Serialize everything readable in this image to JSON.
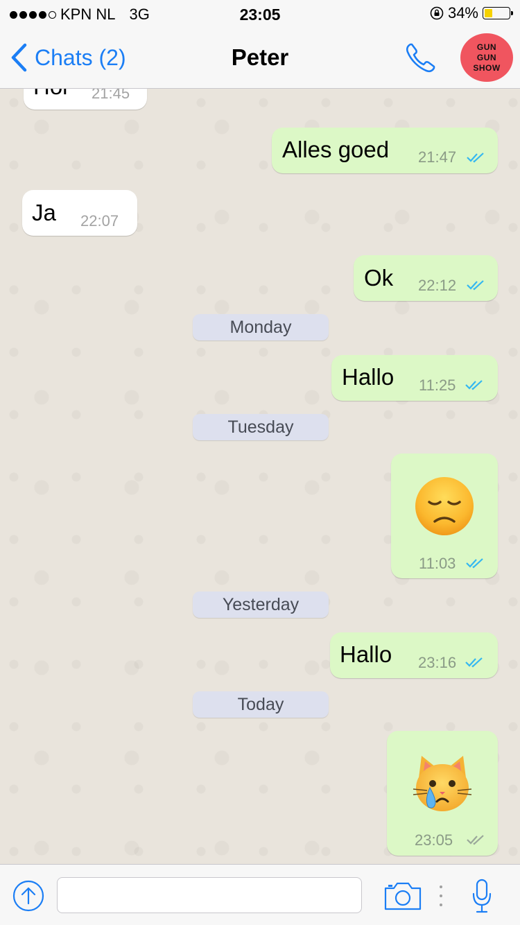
{
  "status_bar": {
    "carrier": "KPN NL",
    "network": "3G",
    "time": "23:05",
    "battery": "34%",
    "battery_level": 0.34
  },
  "nav": {
    "back_label": "Chats (2)",
    "title": "Peter",
    "avatar_text": [
      "GUN",
      "GUN",
      "SHOW"
    ]
  },
  "messages": [
    {
      "dir": "in",
      "text": "Hoi",
      "time": "21:45",
      "ticks": ""
    },
    {
      "dir": "out",
      "text": "Alles goed",
      "time": "21:47",
      "ticks": "read"
    },
    {
      "dir": "in",
      "text": "Ja",
      "time": "22:07",
      "ticks": ""
    },
    {
      "dir": "out",
      "text": "Ok",
      "time": "22:12",
      "ticks": "read"
    },
    {
      "dir": "out",
      "text": "Hallo",
      "time": "11:25",
      "ticks": "read"
    },
    {
      "dir": "out",
      "text": "",
      "emoji": "disappointed-face",
      "time": "11:03",
      "ticks": "read"
    },
    {
      "dir": "out",
      "text": "Hallo",
      "time": "23:16",
      "ticks": "read"
    },
    {
      "dir": "out",
      "text": "",
      "emoji": "crying-cat-face",
      "time": "23:05",
      "ticks": "delivered"
    }
  ],
  "day_separators": [
    "Monday",
    "Tuesday",
    "Yesterday",
    "Today"
  ],
  "input": {
    "placeholder": "",
    "value": ""
  },
  "colors": {
    "accent": "#1b7ef5",
    "outgoing_bubble": "#dcf8c6",
    "incoming_bubble": "#ffffff",
    "read_ticks": "#34b7f1",
    "delivered_ticks": "#9aa79a"
  }
}
